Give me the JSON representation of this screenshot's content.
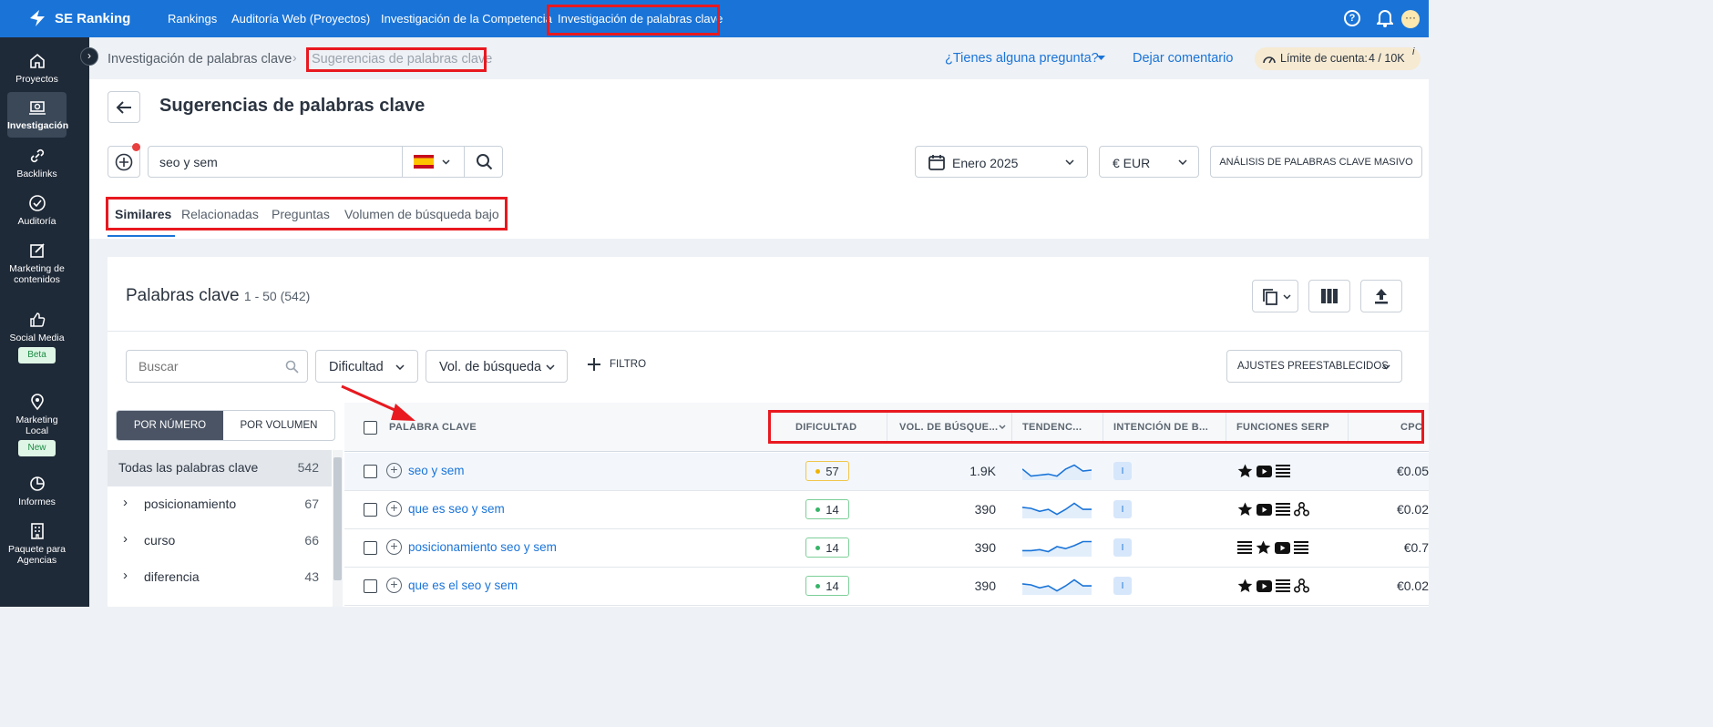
{
  "topbar": {
    "brand": "SE Ranking",
    "nav": [
      "Rankings",
      "Auditoría Web (Proyectos)",
      "Investigación de la Competencia",
      "Investigación de palabras clave"
    ]
  },
  "sidebar": {
    "items": [
      {
        "label": "Proyectos",
        "icon": "home-icon"
      },
      {
        "label": "Investigación",
        "icon": "research-icon"
      },
      {
        "label": "Backlinks",
        "icon": "link-icon"
      },
      {
        "label": "Auditoría",
        "icon": "check-circle-icon"
      },
      {
        "label": "Marketing de contenidos",
        "icon": "edit-icon"
      },
      {
        "label": "Social Media",
        "icon": "thumbs-up-icon",
        "badge": "Beta"
      },
      {
        "label": "Marketing Local",
        "icon": "location-pin-icon",
        "badge": "New"
      },
      {
        "label": "Informes",
        "icon": "pie-chart-icon"
      },
      {
        "label": "Paquete para Agencias",
        "icon": "building-icon"
      }
    ]
  },
  "breadcrumb": {
    "parent": "Investigación de palabras clave",
    "current": "Sugerencias de palabras clave"
  },
  "header_links": {
    "question": "¿Tienes alguna pregunta?",
    "feedback": "Dejar comentario",
    "limit_label": "Límite de cuenta:",
    "limit_value": "4 / 10K",
    "info": "i"
  },
  "page_title": "Sugerencias de palabras clave",
  "search": {
    "value": "seo y sem",
    "country": "ES"
  },
  "controls": {
    "date": "Enero 2025",
    "currency": "€ EUR",
    "bulk": "ANÁLISIS DE PALABRAS CLAVE MASIVO"
  },
  "tabs": [
    "Similares",
    "Relacionadas",
    "Preguntas",
    "Volumen de búsqueda bajo"
  ],
  "results": {
    "title": "Palabras clave",
    "range": "1 - 50 (542)"
  },
  "filters": {
    "search_placeholder": "Buscar",
    "difficulty": "Dificultad",
    "volume": "Vol. de búsqueda",
    "add_filter": "FILTRO",
    "presets": "AJUSTES PREESTABLECIDOS"
  },
  "group_toggle": {
    "by_number": "POR NÚMERO",
    "by_volume": "POR VOLUMEN"
  },
  "groups": [
    {
      "label": "Todas las palabras clave",
      "count": "542"
    },
    {
      "label": "posicionamiento",
      "count": "67"
    },
    {
      "label": "curso",
      "count": "66"
    },
    {
      "label": "diferencia",
      "count": "43"
    }
  ],
  "table": {
    "headers": {
      "keyword": "PALABRA CLAVE",
      "difficulty": "DIFICULTAD",
      "volume": "VOL. DE BÚSQUE...",
      "trend": "TENDENC...",
      "intent": "INTENCIÓN DE B...",
      "serp": "FUNCIONES SERP",
      "cpc": "CPC"
    },
    "rows": [
      {
        "keyword": "seo y sem",
        "difficulty": "57",
        "volume": "1.9K",
        "intent": "I",
        "cpc": "€0.05",
        "serp": [
          "star-icon",
          "video-icon",
          "list-icon"
        ],
        "trend": [
          0.55,
          0.2,
          0.25,
          0.3,
          0.2,
          0.55,
          0.75,
          0.45,
          0.5
        ]
      },
      {
        "keyword": "que es seo y sem",
        "difficulty": "14",
        "volume": "390",
        "intent": "I",
        "cpc": "€0.02",
        "serp": [
          "star-icon",
          "video-icon",
          "list-icon",
          "sitelinks-icon"
        ],
        "trend": [
          0.55,
          0.5,
          0.35,
          0.45,
          0.2,
          0.45,
          0.75,
          0.45,
          0.45
        ]
      },
      {
        "keyword": "posicionamiento seo y sem",
        "difficulty": "14",
        "volume": "390",
        "intent": "I",
        "cpc": "€0.7",
        "serp": [
          "list-icon",
          "star-icon",
          "video-icon",
          "list-icon"
        ],
        "trend": [
          0.3,
          0.3,
          0.35,
          0.25,
          0.5,
          0.4,
          0.55,
          0.75,
          0.75
        ]
      },
      {
        "keyword": "que es el seo y sem",
        "difficulty": "14",
        "volume": "390",
        "intent": "I",
        "cpc": "€0.02",
        "serp": [
          "star-icon",
          "video-icon",
          "list-icon",
          "sitelinks-icon"
        ],
        "trend": [
          0.55,
          0.5,
          0.35,
          0.45,
          0.2,
          0.45,
          0.75,
          0.45,
          0.45
        ]
      }
    ]
  }
}
